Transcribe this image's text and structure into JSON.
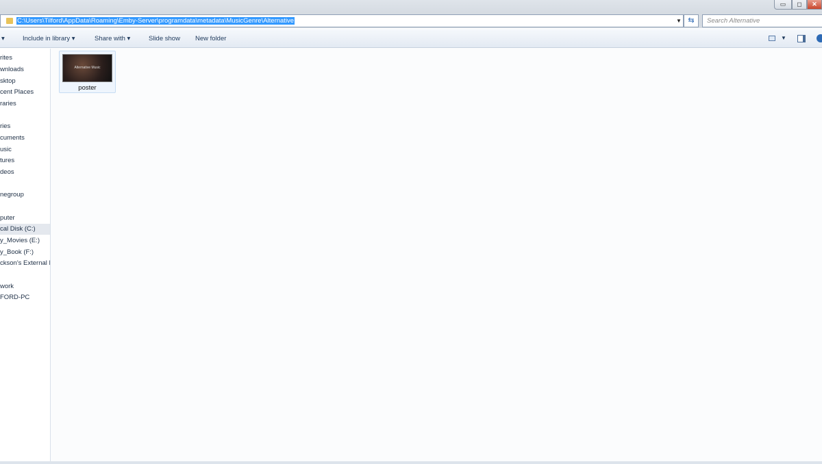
{
  "address": {
    "path": "C:\\Users\\Tilford\\AppData\\Roaming\\Emby-Server\\programdata\\metadata\\MusicGenre\\Alternative",
    "search_placeholder": "Search Alternative"
  },
  "toolbar": {
    "include_in_library": "Include in library ▾",
    "share_with": "Share with ▾",
    "slide_show": "Slide show",
    "new_folder": "New folder"
  },
  "sidebar": {
    "items": [
      "rites",
      "wnloads",
      "sktop",
      "cent Places",
      "raries",
      "ries",
      "cuments",
      "usic",
      "tures",
      "deos",
      "negroup",
      "puter",
      "cal Disk (C:)",
      "y_Movies (E:)",
      "y_Book (F:)",
      "ckson's External D",
      "work",
      "FORD-PC"
    ]
  },
  "files": [
    {
      "name": "poster",
      "thumb_text": "Alternative Music"
    }
  ]
}
